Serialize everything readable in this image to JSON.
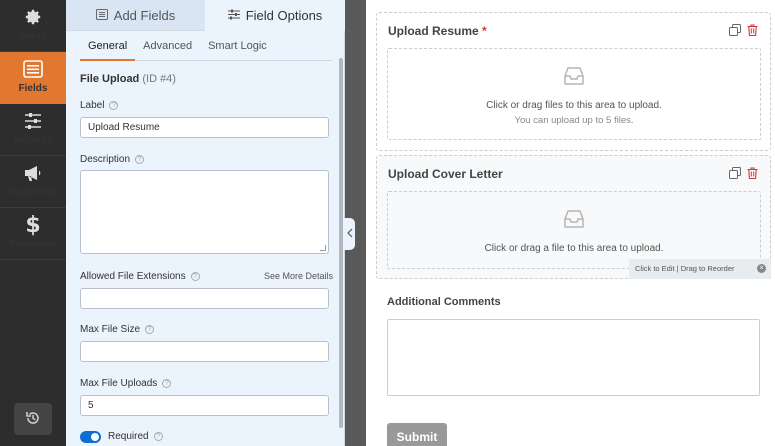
{
  "nav": {
    "items": [
      {
        "label": "Setup",
        "icon": "gear-icon"
      },
      {
        "label": "Fields",
        "icon": "list-icon"
      },
      {
        "label": "Settings",
        "icon": "sliders-icon"
      },
      {
        "label": "Marketing",
        "icon": "megaphone-icon"
      },
      {
        "label": "Payments",
        "icon": "dollar-icon"
      }
    ],
    "active": "Fields",
    "accent": "#e27730"
  },
  "panel": {
    "tab_add": "Add Fields",
    "tab_options": "Field Options",
    "subtabs": [
      "General",
      "Advanced",
      "Smart Logic"
    ],
    "field_name": "File Upload",
    "field_id": "(ID #4)",
    "label_label": "Label",
    "label_value": "Upload Resume",
    "description_label": "Description",
    "extensions_label": "Allowed File Extensions",
    "see_more": "See More Details",
    "max_size_label": "Max File Size",
    "max_uploads_label": "Max File Uploads",
    "max_uploads_value": "5",
    "required_label": "Required"
  },
  "preview": {
    "field1": {
      "title": "Upload Resume",
      "required_mark": "*",
      "drop_text": "Click or drag files to this area to upload.",
      "drop_sub": "You can upload up to 5 files."
    },
    "field2": {
      "title": "Upload Cover Letter",
      "drop_text": "Click or drag a file to this area to upload.",
      "hint": "Click to Edit | Drag to Reorder"
    },
    "comments_label": "Additional Comments",
    "submit_label": "Submit"
  }
}
